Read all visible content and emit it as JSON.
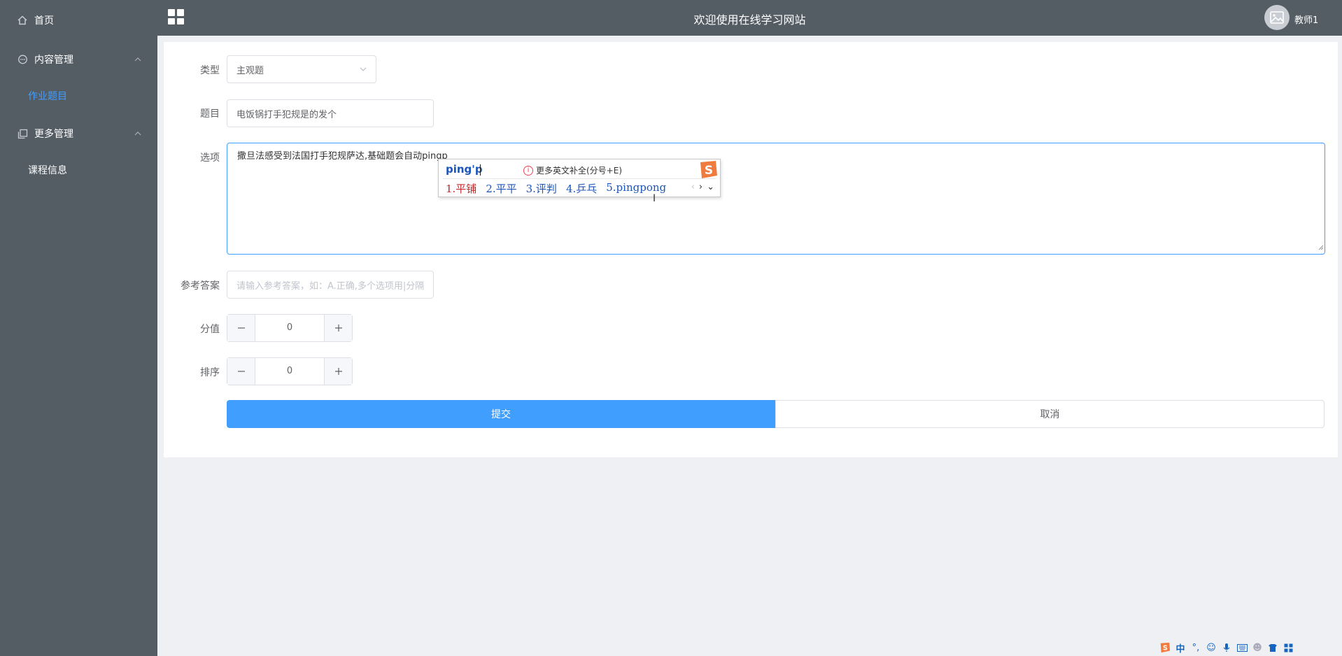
{
  "sidebar": {
    "home": "首页",
    "content_mgmt": "内容管理",
    "homework": "作业题目",
    "more_mgmt": "更多管理",
    "course_info": "课程信息"
  },
  "header": {
    "title": "欢迎使用在线学习网站",
    "user": "教师1"
  },
  "form": {
    "type_label": "类型",
    "type_value": "主观题",
    "question_label": "题目",
    "question_value": "电饭锅打手犯规是的发个",
    "options_label": "选项",
    "options_value": "撒旦法感受到法国打手犯规萨达,基础题会自动pingp",
    "answer_label": "参考答案",
    "answer_placeholder": "请输入参考答案，如：A.正确,多个选项用|分隔",
    "score_label": "分值",
    "score_value": "0",
    "order_label": "排序",
    "order_value": "0",
    "submit": "提交",
    "cancel": "取消"
  },
  "ime": {
    "composition": "ping'p",
    "hint": "更多英文补全(分号+E)",
    "candidates": [
      "1.平铺",
      "2.平平",
      "3.评判",
      "4.乒乓",
      "5.pingpong"
    ]
  },
  "tray": {
    "lang": "中",
    "punct": "°,"
  },
  "colors": {
    "sidebar_bg": "#545c64",
    "active_menu": "#409eff",
    "primary": "#409eff"
  }
}
